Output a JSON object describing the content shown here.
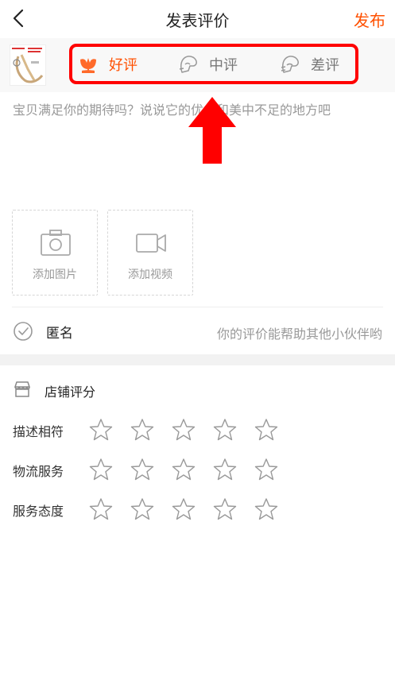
{
  "header": {
    "title": "发表评价",
    "publish_label": "发布"
  },
  "rating": {
    "options": [
      {
        "label": "好评",
        "icon": "flower-icon",
        "selected": true,
        "color": "#ff5000"
      },
      {
        "label": "中评",
        "icon": "neutral-face-icon",
        "selected": false,
        "color": "#777777"
      },
      {
        "label": "差评",
        "icon": "sad-face-icon",
        "selected": false,
        "color": "#777777"
      }
    ],
    "highlight_color": "#ff0000"
  },
  "comment": {
    "placeholder": "宝贝满足你的期待吗？说说它的优点和美中不足的地方吧",
    "value": ""
  },
  "media": {
    "photo_label": "添加图片",
    "video_label": "添加视频"
  },
  "anonymous": {
    "label": "匿名",
    "checked": false,
    "hint": "你的评价能帮助其他小伙伴哟"
  },
  "shop": {
    "title": "店铺评分",
    "rows": [
      {
        "label": "描述相符",
        "stars": 0,
        "max": 5
      },
      {
        "label": "物流服务",
        "stars": 0,
        "max": 5
      },
      {
        "label": "服务态度",
        "stars": 0,
        "max": 5
      }
    ]
  },
  "colors": {
    "accent": "#ff5000",
    "annotation_arrow": "#ff0000"
  }
}
